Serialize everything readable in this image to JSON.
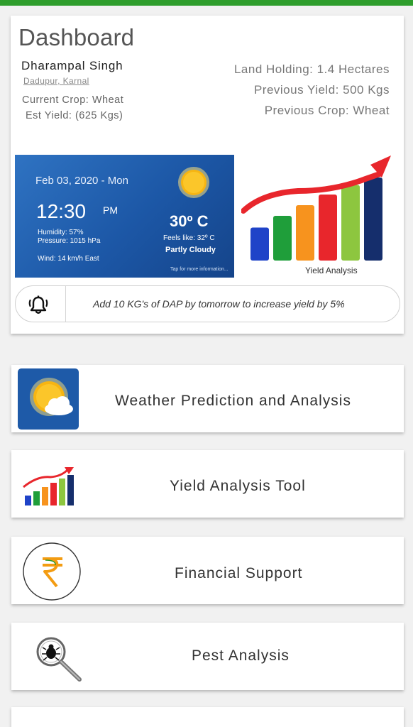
{
  "dashboard": {
    "title": "Dashboard",
    "farmer_name": "Dharampal Singh",
    "location": "Dadupur, Karnal",
    "current_crop": "Current Crop: Wheat",
    "est_yield": "Est Yield: (625 Kgs)",
    "land_holding": "Land Holding:  1.4 Hectares",
    "previous_yield": "Previous Yield: 500 Kgs",
    "previous_crop": "Previous Crop: Wheat"
  },
  "weather_widget": {
    "date": "Feb 03, 2020 - Mon",
    "time": "12:30",
    "ampm": "PM",
    "humidity": "Humidity: 57%",
    "pressure": "Pressure: 1015 hPa",
    "wind": "Wind: 14 km/h East",
    "temperature": "30º C",
    "feels_like": "Feels like: 32º C",
    "condition": "Partly Cloudy",
    "tap_hint": "Tap for more information...",
    "icon": "sun-icon"
  },
  "yield_widget": {
    "label": "Yield Analysis",
    "icon": "bar-chart-arrow-icon",
    "bar_colors": [
      "#1f43c8",
      "#1f9e3a",
      "#f7931e",
      "#e8262c",
      "#8dc63f",
      "#152e6c"
    ],
    "bar_levels": [
      0.31,
      0.42,
      0.52,
      0.62,
      0.71,
      0.78
    ],
    "arrow_color": "#e8262c"
  },
  "alert": {
    "icon": "bell-icon",
    "text": "Add 10 KG's of DAP by tomorrow to increase yield by 5%"
  },
  "menu": [
    {
      "label": "Weather Prediction and Analysis",
      "icon": "weather-sun-cloud-icon"
    },
    {
      "label": "Yield Analysis Tool",
      "icon": "yield-chart-icon"
    },
    {
      "label": "Financial Support",
      "icon": "rupee-icon"
    },
    {
      "label": "Pest Analysis",
      "icon": "pest-magnifier-icon"
    }
  ],
  "colors": {
    "top_bar": "#2e9d2c",
    "weather_blue": "#1c57a6"
  }
}
